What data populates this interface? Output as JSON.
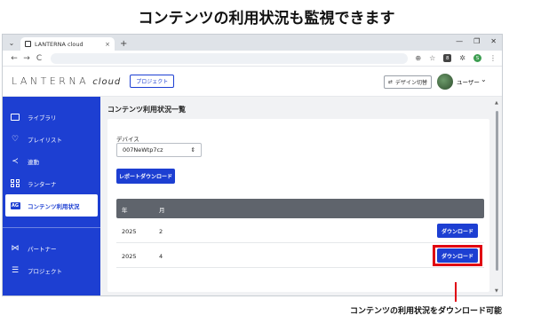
{
  "caption_top": "コンテンツの利用状況も監視できます",
  "caption_bottom": "コンテンツの利用状況をダウンロード可能",
  "browser": {
    "tab_title": "LANTERNA cloud",
    "tab_close": "×",
    "new_tab": "+",
    "menu_glyph": "⌄",
    "win_min": "—",
    "win_restore": "❐",
    "win_close": "✕",
    "nav_back": "←",
    "nav_forward": "→",
    "nav_reload": "C",
    "zoom_icon": "⊕",
    "star_icon": "☆",
    "ext_badge": "8",
    "puzzle_icon": "✲",
    "profile": "S",
    "kebab": "⋮"
  },
  "header": {
    "logo": "LANTERNA",
    "logo_suffix": "cloud",
    "project_button": "プロジェクト",
    "design_switch": "デザイン切替",
    "design_icon": "⇄",
    "user": "ユーザー",
    "user_chevron": "⌄"
  },
  "sidebar": {
    "items": [
      {
        "label": "ライブラリ",
        "icon": "folder-icon"
      },
      {
        "label": "プレイリスト",
        "icon": "heart-icon"
      },
      {
        "label": "連動",
        "icon": "share-icon"
      },
      {
        "label": "ランターナ",
        "icon": "grid-icon"
      },
      {
        "label": "コンテンツ利用状況",
        "icon": "usage-icon",
        "active": true
      }
    ],
    "bottom_items": [
      {
        "label": "パートナー",
        "icon": "partner-icon"
      },
      {
        "label": "プロジェクト",
        "icon": "list-icon"
      }
    ],
    "icons": {
      "heart": "♡",
      "share": "≺",
      "partner": "⋈",
      "list": "☰",
      "usage": "AG"
    }
  },
  "main": {
    "title": "コンテンツ利用状況一覧",
    "device_label": "デバイス",
    "device_value": "007NeWtp7cz",
    "device_toggle": "⇕",
    "report_button": "レポートダウンロード",
    "table": {
      "headers": [
        "年",
        "月"
      ],
      "rows": [
        {
          "year": "2025",
          "month": "2",
          "action": "ダウンロード"
        },
        {
          "year": "2025",
          "month": "4",
          "action": "ダウンロード"
        }
      ]
    },
    "scroll_up": "▲",
    "scroll_down": "▼"
  },
  "colors": {
    "brand_blue": "#1d3fd2",
    "highlight_red": "#e00012",
    "table_header": "#5f646c"
  }
}
